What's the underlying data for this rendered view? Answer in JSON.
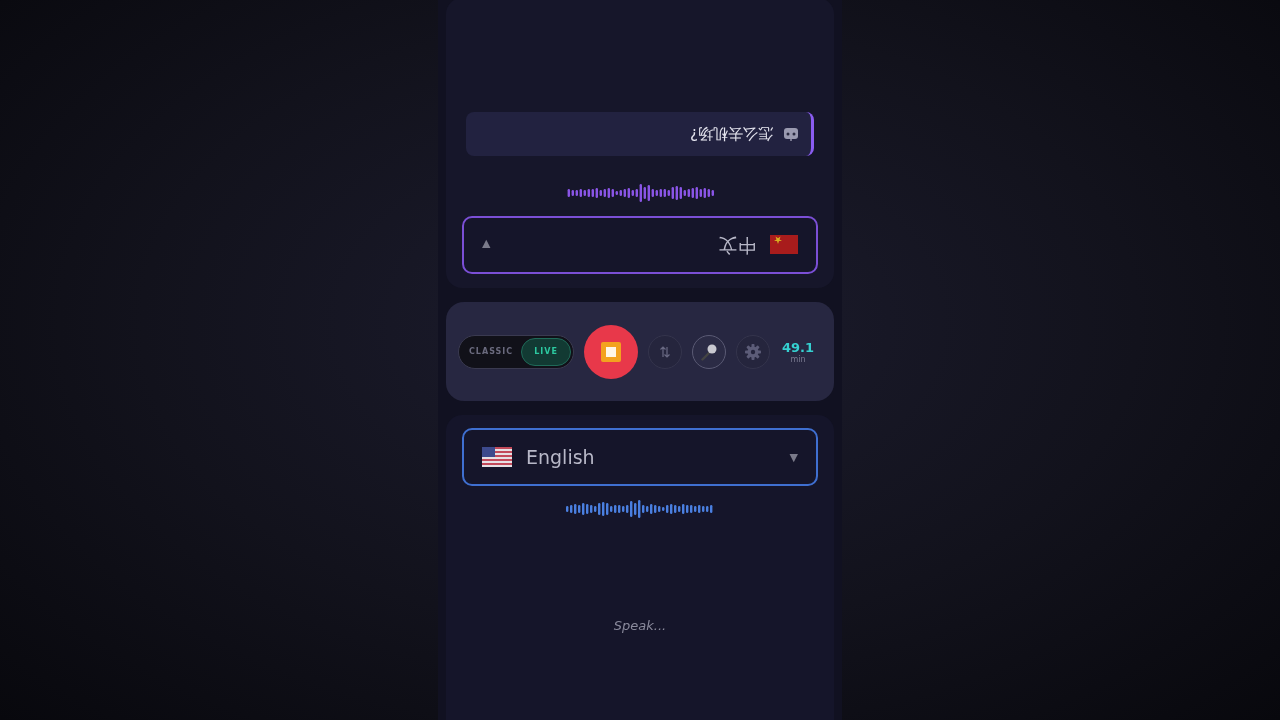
{
  "top_panel": {
    "language": {
      "kind": "cn",
      "label": "中文",
      "caret": "▼"
    },
    "translation": {
      "text": "怎么去机场?"
    }
  },
  "controls": {
    "modes": [
      {
        "label": "CLASSIC",
        "selected": false
      },
      {
        "label": "LIVE",
        "selected": true
      }
    ],
    "recording": true,
    "usage": {
      "value": "49.1",
      "unit": "min"
    }
  },
  "bottom_panel": {
    "language": {
      "kind": "us",
      "label": "English",
      "caret": "▼"
    },
    "placeholder": "Speak..."
  }
}
